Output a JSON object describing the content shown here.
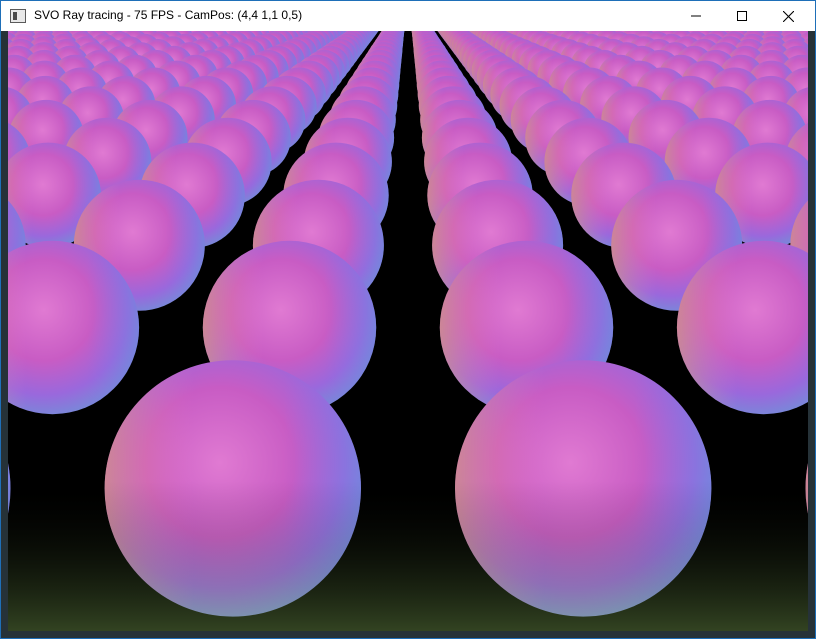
{
  "window": {
    "title": "SVO Ray tracing - 75 FPS - CamPos: (4,4 1,1 0,5)",
    "icon": "app-window-icon",
    "controls": {
      "minimize_icon": "minimize-icon",
      "maximize_icon": "maximize-icon",
      "close_icon": "close-icon"
    }
  },
  "viewport": {
    "content": "rendered-sphere-grid",
    "colors": {
      "pink": "#d868c8",
      "magenta": "#c050c0",
      "violet": "#9a70e0",
      "orange": "#e89060",
      "green": "#80b860",
      "background": "#000000"
    }
  }
}
